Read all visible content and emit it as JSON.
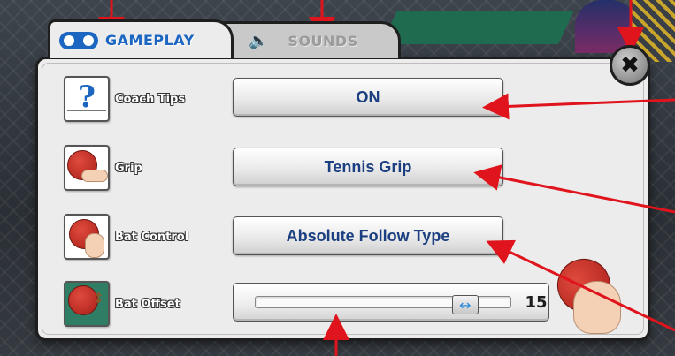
{
  "tabs": [
    {
      "label": "GAMEPLAY",
      "icon": "gamepad-icon",
      "active": true
    },
    {
      "label": "SOUNDS",
      "icon": "speaker-icon",
      "active": false
    }
  ],
  "close_button": {
    "icon": "close-icon",
    "glyph": "✖"
  },
  "settings": [
    {
      "label": "Coach Tips",
      "icon": "coach-tips-icon",
      "value": "ON"
    },
    {
      "label": "Grip",
      "icon": "grip-icon",
      "value": "Tennis Grip"
    },
    {
      "label": "Bat Control",
      "icon": "bat-control-icon",
      "value": "Absolute Follow Type"
    },
    {
      "label": "Bat Offset",
      "icon": "bat-offset-icon",
      "value": "15",
      "slider_level": 0.86
    }
  ],
  "slider_handle_glyph": "↔",
  "colors": {
    "accent": "#1c66c2",
    "option_text": "#1b3f80",
    "panel": "#ececec",
    "annotation": "#e0141c"
  }
}
